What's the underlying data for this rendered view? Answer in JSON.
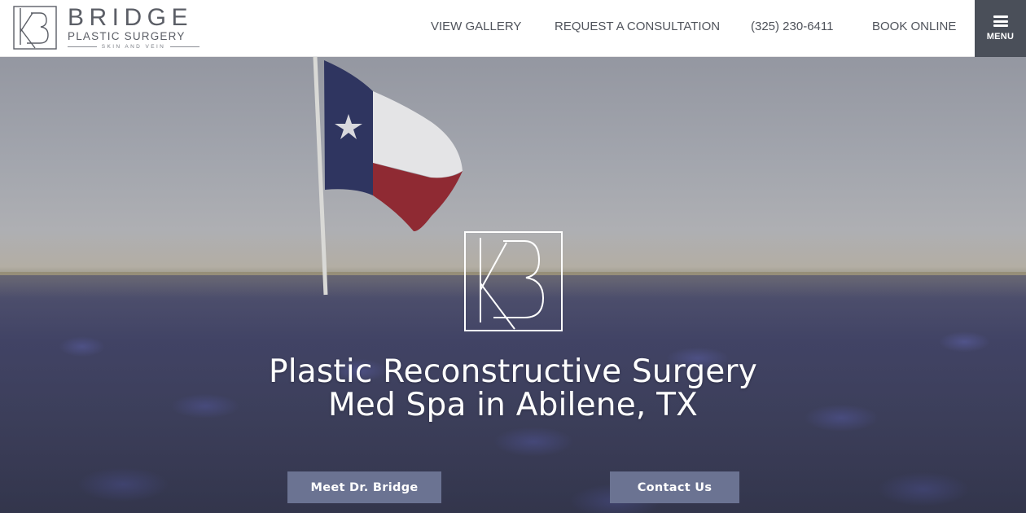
{
  "brand": {
    "name": "BRIDGE",
    "subtitle": "PLASTIC SURGERY",
    "tagline": "SKIN AND VEIN",
    "logo_icon": "kb-monogram-icon"
  },
  "nav": {
    "gallery": "VIEW GALLERY",
    "consultation": "REQUEST A CONSULTATION",
    "phone": "(325) 230-6411",
    "book": "BOOK ONLINE",
    "menu_label": "MENU",
    "menu_icon": "hamburger-icon"
  },
  "hero": {
    "headline_line1": "Plastic Reconstructive Surgery",
    "headline_line2": "Med Spa in Abilene, TX",
    "logo_icon": "kb-monogram-icon",
    "buttons": {
      "meet": "Meet Dr. Bridge",
      "contact": "Contact Us"
    }
  },
  "colors": {
    "header_bg": "#ffffff",
    "nav_text": "#4f535b",
    "menu_bg": "#4a4f59",
    "button_bg": "#6b7392",
    "headline": "#ffffff"
  }
}
